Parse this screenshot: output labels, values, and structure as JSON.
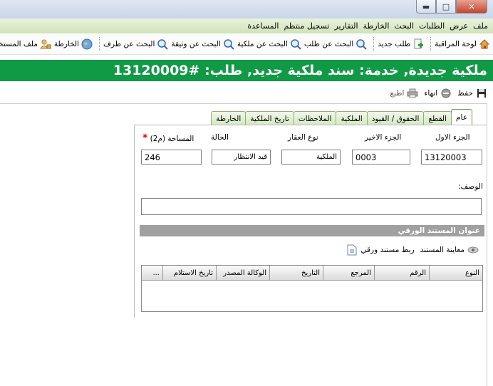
{
  "menu": [
    "ملف",
    "عرض",
    "الطلبات",
    "البحث",
    "الخارطة",
    "التقارير",
    "تسجيل منتظم",
    "المساعدة"
  ],
  "toolbar": {
    "items": [
      {
        "label": "لوحة المراقبة",
        "icon": "home-icon"
      },
      {
        "label": "طلب جديد",
        "icon": "new-request-icon"
      },
      {
        "label": "البحث عن طلب",
        "icon": "search-icon"
      },
      {
        "label": "البحث عن ملكية",
        "icon": "search-icon"
      },
      {
        "label": "البحث عن وثيقة",
        "icon": "search-icon"
      },
      {
        "label": "البحث عن طرف",
        "icon": "search-icon"
      },
      {
        "label": "الخارطة",
        "icon": "globe-icon"
      },
      {
        "label": "ملف المستخدم",
        "icon": "user-lock-icon"
      }
    ]
  },
  "banner": {
    "title": "ملكية جديدة, خدمة: سند ملكية جديد, طلب: #13120009"
  },
  "actions": {
    "save": "حفظ",
    "finish": "انهاء",
    "print": "اطبع"
  },
  "tabs": [
    "عام",
    "القطع",
    "الحقوق / القيود",
    "الملكية",
    "الملاحظات",
    "تاريخ الملكية",
    "الخارطة"
  ],
  "form": {
    "part_first_label": "الجزء الاول",
    "part_first_value": "13120003",
    "part_last_label": "الجزء الاخير",
    "part_last_value": "0003",
    "property_type_label": "نوع العقار",
    "property_type_value": "الملكية",
    "status_label": "الحالة",
    "status_value": "قيد الانتظار",
    "area_label": "المساحة (م2)",
    "area_required": "*",
    "area_value": "246",
    "description_label": "الوصف:",
    "description_value": ""
  },
  "paper_doc": {
    "section_title": "عنوان المستند الورقي",
    "preview_label": "معاينة المستند",
    "link_label": "ربط مستند ورقي"
  },
  "grid": {
    "columns": [
      "النوع",
      "الرقم",
      "المرجع",
      "التاريخ",
      "الوكالة المصدر",
      "تاريخ الاستلام",
      "..."
    ]
  }
}
